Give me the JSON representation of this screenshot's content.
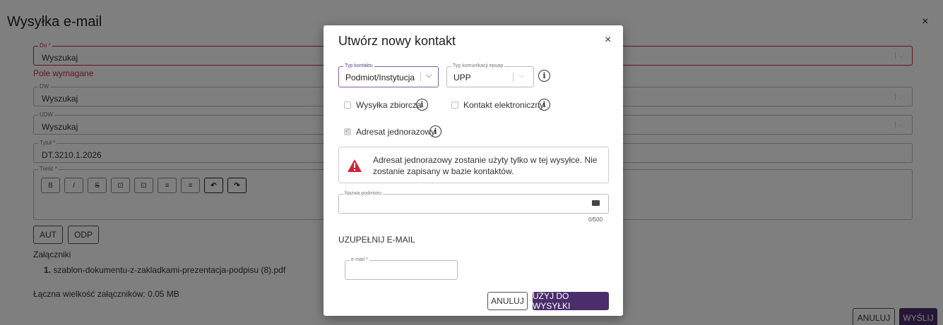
{
  "background": {
    "title": "Wysyłka e-mail",
    "close": "×",
    "to_field": {
      "label": "Do *",
      "value": "Wyszukaj"
    },
    "to_error": "Pole wymagane",
    "cc_field": {
      "label": "DW",
      "value": "Wyszukaj"
    },
    "bcc_field": {
      "label": "UDW",
      "value": "Wyszukaj"
    },
    "subject_field": {
      "label": "Tytuł *",
      "value": "DT.3210.1.2026"
    },
    "body_field": {
      "label": "Treść *"
    },
    "toolbar": [
      "B",
      "I",
      "S",
      "⊡",
      "⊡",
      "≡",
      "≡",
      "↶",
      "↷"
    ],
    "aut_label": "AUT",
    "odp_label": "ODP",
    "attachments_heading": "Załączniki",
    "attachment_number": "1.",
    "attachment_name": "szablon-dokumentu-z-zakladkami-prezentacja-podpisu (8).pdf",
    "total_size": "Łączna wielkość załączników: 0.05 MB",
    "cancel_label": "ANULUJ",
    "send_label": "WYŚLIJ"
  },
  "modal": {
    "title": "Utwórz nowy kontakt",
    "close": "×",
    "contact_type": {
      "label": "Typ kontaktu",
      "value": "Podmiot/Instytucja"
    },
    "epuap_type": {
      "label": "Typ komunikacji epuap",
      "value": "UPP"
    },
    "bulk_label": "Wysyłka zbiorcza",
    "electronic_label": "Kontakt elektroniczny",
    "onetime_label": "Adresat jednorazowy",
    "warning": "Adresat jednorazowy zostanie użyty tylko w tej wysyłce. Nie zostanie zapisany w bazie kontaktów.",
    "name_field_label": "Nazwa podmiotu",
    "name_counter": "0/500",
    "email_section": "UZUPEŁNIJ E-MAIL",
    "email_field_label": "e-mail *",
    "cancel_label": "ANULUJ",
    "use_label": "UŻYJ DO WYSYŁKI"
  },
  "colors": {
    "accent": "#4a2d6b",
    "error": "#c7283a",
    "warning": "#d0233a"
  }
}
